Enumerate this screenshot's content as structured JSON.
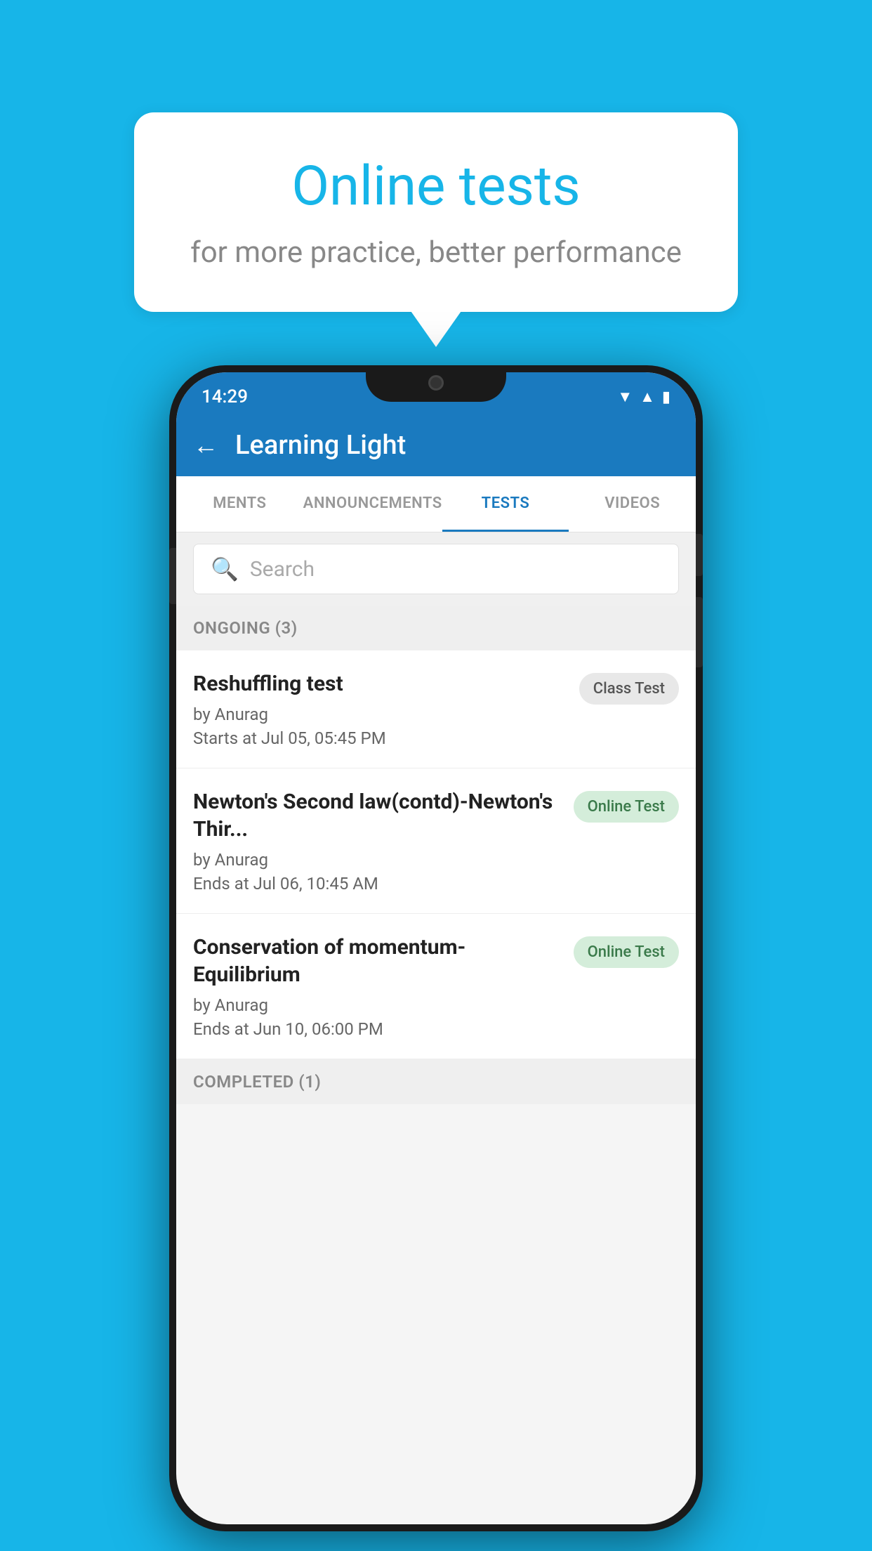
{
  "promo": {
    "title": "Online tests",
    "subtitle": "for more practice, better performance"
  },
  "phone": {
    "status": {
      "time": "14:29",
      "icons": [
        "wifi",
        "signal",
        "battery"
      ]
    },
    "header": {
      "back_label": "←",
      "title": "Learning Light"
    },
    "tabs": [
      {
        "label": "MENTS",
        "active": false
      },
      {
        "label": "ANNOUNCEMENTS",
        "active": false
      },
      {
        "label": "TESTS",
        "active": true
      },
      {
        "label": "VIDEOS",
        "active": false
      }
    ],
    "search": {
      "placeholder": "Search"
    },
    "sections": [
      {
        "header": "ONGOING (3)",
        "items": [
          {
            "name": "Reshuffling test",
            "by": "by Anurag",
            "date": "Starts at  Jul 05, 05:45 PM",
            "badge": "Class Test",
            "badge_type": "class"
          },
          {
            "name": "Newton's Second law(contd)-Newton's Thir...",
            "by": "by Anurag",
            "date": "Ends at  Jul 06, 10:45 AM",
            "badge": "Online Test",
            "badge_type": "online"
          },
          {
            "name": "Conservation of momentum-Equilibrium",
            "by": "by Anurag",
            "date": "Ends at  Jun 10, 06:00 PM",
            "badge": "Online Test",
            "badge_type": "online"
          }
        ]
      }
    ],
    "completed_header": "COMPLETED (1)"
  },
  "colors": {
    "background": "#17b5e8",
    "header_blue": "#1a7abf",
    "active_tab": "#1a7abf",
    "badge_class_bg": "#e8e8e8",
    "badge_class_text": "#555",
    "badge_online_bg": "#d4edda",
    "badge_online_text": "#3a7a4a"
  }
}
